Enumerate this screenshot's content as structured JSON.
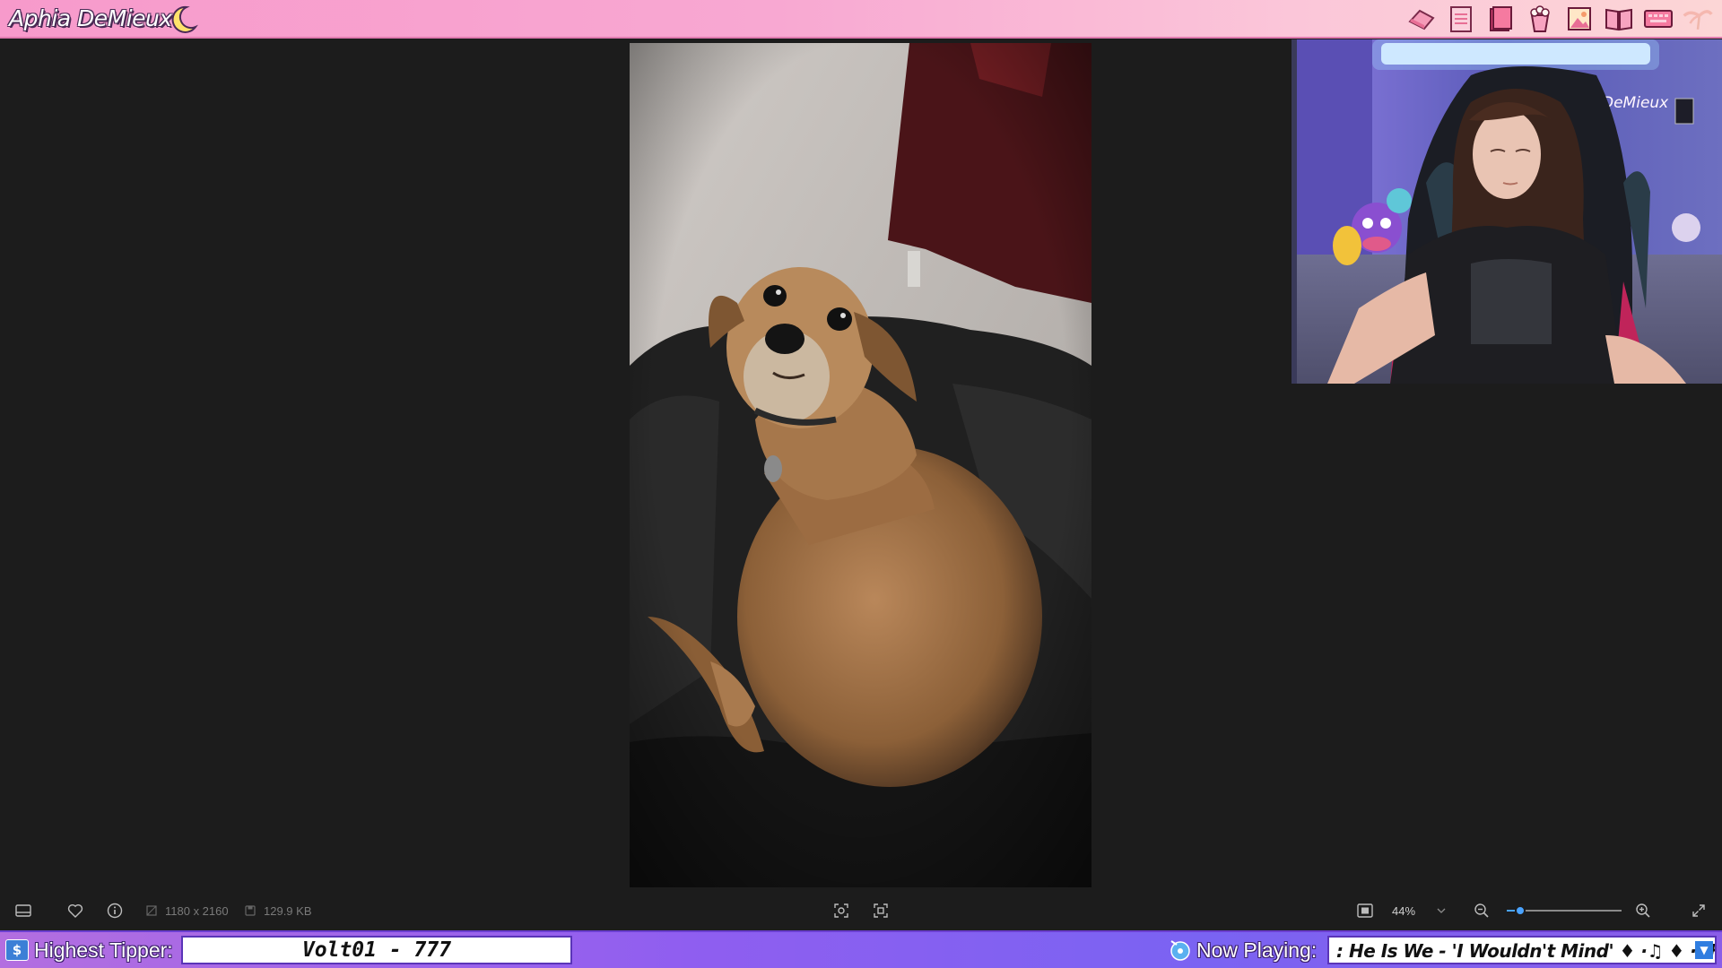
{
  "stream": {
    "streamer_name": "Aphia DeMieux",
    "highest_tipper_label": "Highest Tipper:",
    "highest_tipper_value": "Volt01 - 777",
    "now_playing_label": "Now Playing:",
    "now_playing_track": ": He Is We - 'I Wouldn't Mind' ♦ ·♫ ♦ ·: He Is W"
  },
  "top_icons": [
    "eraser-icon",
    "notepad-icon",
    "folder-icon",
    "popcorn-icon",
    "picture-icon",
    "book-icon",
    "keyboard-icon",
    "palm-tree-icon"
  ],
  "webcam": {
    "neon_sign": "DeMieux"
  },
  "viewer_toolbar": {
    "dimensions": "1180 x 2160",
    "file_size": "129.9 KB",
    "zoom_label": "44%",
    "zoom_fraction": 0.12
  },
  "colors": {
    "top_banner": "#f79acb",
    "bottom_banner": "#8f5ef0",
    "viewer_background": "#1c1c1c",
    "accent": "#4aa3ff"
  }
}
